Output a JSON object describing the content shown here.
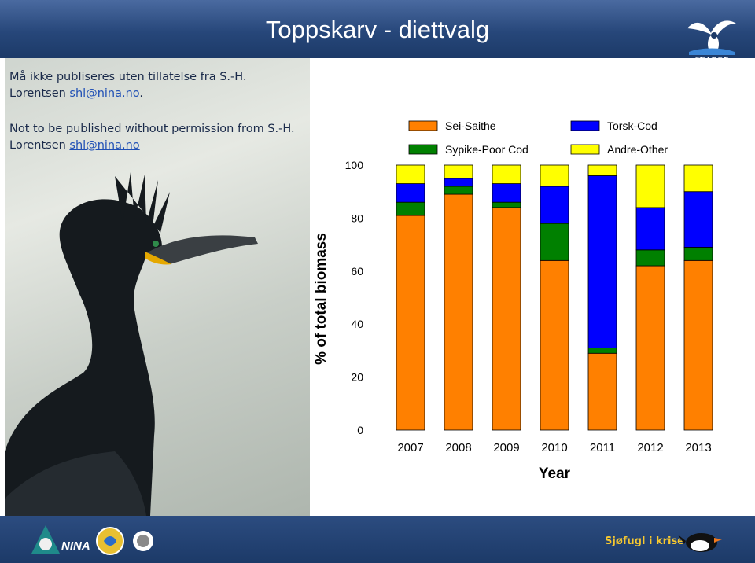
{
  "header": {
    "title": "Toppskarv - diettvalg"
  },
  "notices": {
    "norwegian": {
      "text": "Må ikke publiseres uten tillatelse fra S.-H. Lorentsen ",
      "email": "shl@nina.no",
      "suffix": "."
    },
    "english": {
      "text": "Not to be published without permission from S.-H. Lorentsen ",
      "email": "shl@nina.no",
      "suffix": ""
    }
  },
  "logos": {
    "seapop": "SEAPOP",
    "nina": "NINA"
  },
  "footer": {
    "label": "Sjøfugl i krise"
  },
  "colors": {
    "banner": "#27477a",
    "orange": "#ff8000",
    "green": "#008000",
    "blue": "#0000ff",
    "yellow": "#ffff00"
  },
  "chart_data": {
    "type": "bar",
    "stacked": true,
    "categories": [
      "2007",
      "2008",
      "2009",
      "2010",
      "2011",
      "2012",
      "2013"
    ],
    "series": [
      {
        "name": "Sei-Saithe",
        "color": "#ff8000",
        "values": [
          81,
          89,
          84,
          64,
          29,
          62,
          64
        ]
      },
      {
        "name": "Sypike-Poor Cod",
        "color": "#008000",
        "values": [
          5,
          3,
          2,
          14,
          2,
          6,
          5
        ]
      },
      {
        "name": "Torsk-Cod",
        "color": "#0000ff",
        "values": [
          7,
          3,
          7,
          14,
          65,
          16,
          21
        ]
      },
      {
        "name": "Andre-Other",
        "color": "#ffff00",
        "values": [
          7,
          5,
          7,
          8,
          4,
          16,
          10
        ]
      }
    ],
    "xlabel": "Year",
    "ylabel": "% of total biomass",
    "ylim": [
      0,
      100
    ],
    "yticks": [
      "0",
      "20",
      "40",
      "60",
      "80",
      "100"
    ],
    "legend": "top"
  }
}
